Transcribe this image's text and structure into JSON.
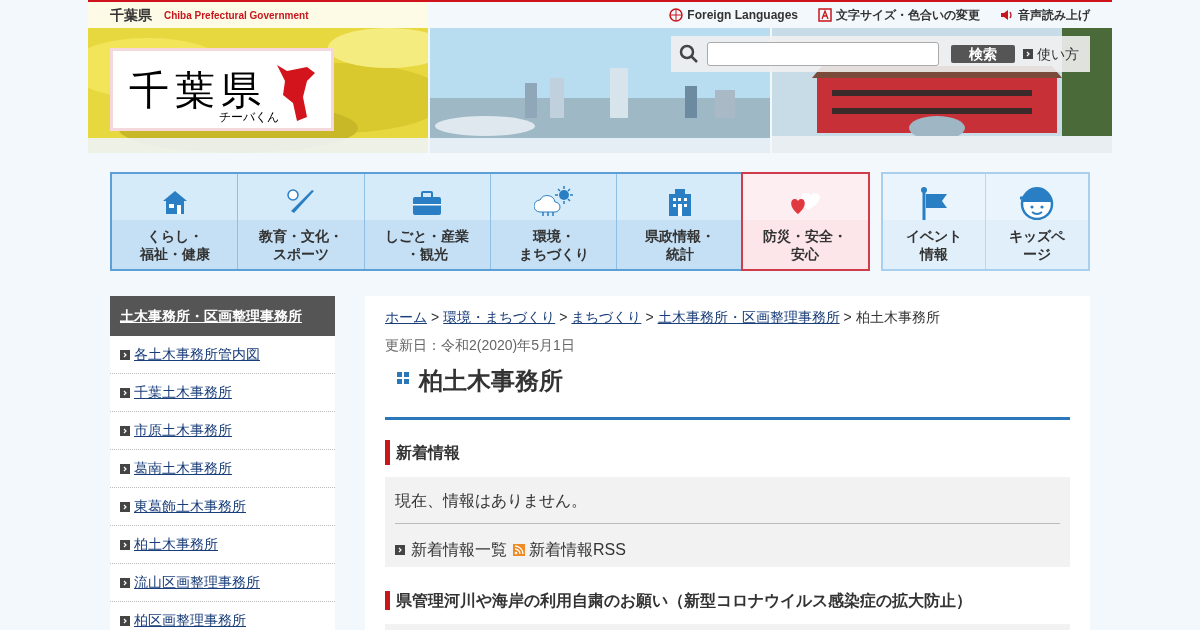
{
  "header": {
    "site_name": "千葉県",
    "site_name_en": "Chiba Prefectural Government",
    "utility_links": [
      "Foreign Languages",
      "文字サイズ・色合いの変更",
      "音声読み上げ"
    ]
  },
  "search": {
    "button": "検索",
    "help_link": "使い方"
  },
  "logo": {
    "title": "千葉県",
    "caption": "チーバくん"
  },
  "nav": {
    "main": [
      {
        "lines": [
          "くらし・",
          "福祉・健康"
        ],
        "selected": false
      },
      {
        "lines": [
          "教育・文化・",
          "スポーツ"
        ],
        "selected": false
      },
      {
        "lines": [
          "しごと・産業",
          "・観光"
        ],
        "selected": false
      },
      {
        "lines": [
          "環境・",
          "まちづくり"
        ],
        "selected": false
      },
      {
        "lines": [
          "県政情報・",
          "統計"
        ],
        "selected": false
      },
      {
        "lines": [
          "防災・安全・",
          "安心"
        ],
        "selected": true
      }
    ],
    "sub": [
      {
        "lines": [
          "イベント",
          "情報"
        ]
      },
      {
        "lines": [
          "キッズペ",
          "ージ"
        ]
      }
    ]
  },
  "sidebar": {
    "heading": "土木事務所・区画整理事務所",
    "items": [
      "各土木事務所管内図",
      "千葉土木事務所",
      "市原土木事務所",
      "葛南土木事務所",
      "東葛飾土木事務所",
      "柏土木事務所",
      "流山区画整理事務所",
      "柏区画整理事務所"
    ]
  },
  "breadcrumb": {
    "links": [
      "ホーム",
      "環境・まちづくり",
      "まちづくり",
      "土木事務所・区画整理事務所"
    ],
    "current": "柏土木事務所",
    "separator": ">"
  },
  "updated": "更新日：令和2(2020)年5月1日",
  "title": "柏土木事務所",
  "news": {
    "heading": "新着情報",
    "message": "現在、情報はありません。",
    "list_link": "新着情報一覧",
    "rss_link": "新着情報RSS"
  },
  "notice": {
    "heading": "県管理河川や海岸の利用自粛のお願い（新型コロナウイルス感染症の拡大防止）"
  }
}
